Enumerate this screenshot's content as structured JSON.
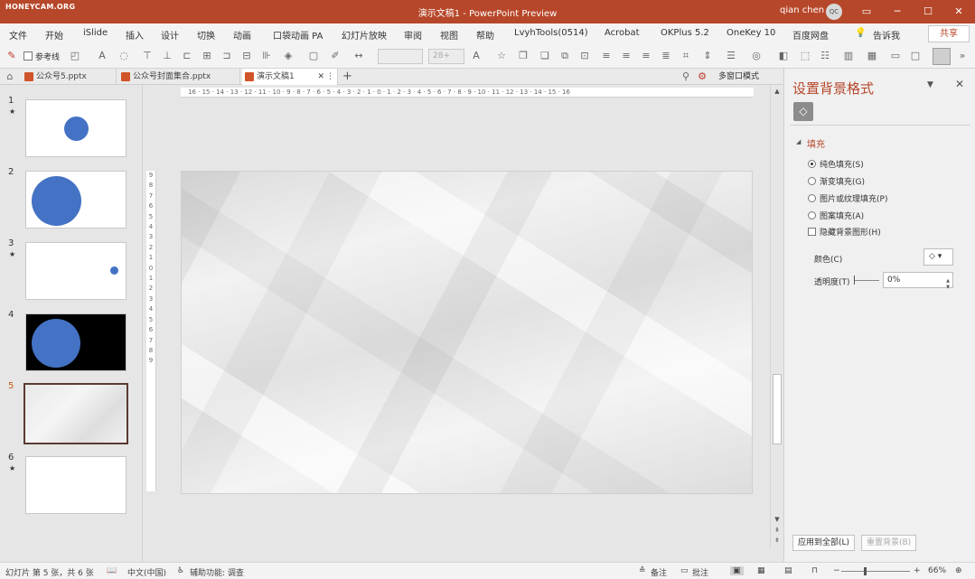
{
  "titlebar": {
    "watermark": "HONEYCAM.ORG",
    "title": "演示文稿1  -  PowerPoint Preview",
    "user": "qian chen",
    "avatar": "QC"
  },
  "ribbon": {
    "tabs": [
      "文件",
      "开始",
      "iSlide",
      "插入",
      "设计",
      "切换",
      "动画",
      "口袋动画 PA",
      "幻灯片放映",
      "审阅",
      "视图",
      "帮助",
      "LvyhTools(0514)",
      "Acrobat",
      "OKPlus 5.2",
      "OneKey 10",
      "百度网盘"
    ],
    "tell_me": "告诉我",
    "share": "共享"
  },
  "toolbar": {
    "guides_label": "参考线",
    "font_size": "28+"
  },
  "doctabs": [
    {
      "label": "公众号5.pptx"
    },
    {
      "label": "公众号封面集合.pptx"
    },
    {
      "label": "演示文稿1"
    }
  ],
  "multiwindow": "多窗口模式",
  "thumbnails": [
    {
      "num": "1",
      "star": "★"
    },
    {
      "num": "2",
      "star": ""
    },
    {
      "num": "3",
      "star": "★"
    },
    {
      "num": "4",
      "star": ""
    },
    {
      "num": "5",
      "star": ""
    },
    {
      "num": "6",
      "star": "★"
    }
  ],
  "rulers": {
    "horizontal": "16 · 15 · 14 · 13 · 12 · 11 · 10 · 9 · 8 · 7 · 6 · 5 · 4 · 3 · 2 · 1 · 0 · 1 · 2 · 3 · 4 · 5 · 6 · 7 · 8 · 9 · 10 · 11 · 12 · 13 · 14 · 15 · 16",
    "vertical": [
      "9",
      "8",
      "7",
      "6",
      "5",
      "4",
      "3",
      "2",
      "1",
      "0",
      "1",
      "2",
      "3",
      "4",
      "5",
      "6",
      "7",
      "8",
      "9"
    ]
  },
  "format_pane": {
    "title": "设置背景格式",
    "section": "填充",
    "fill_options": [
      "纯色填充(S)",
      "渐变填充(G)",
      "图片或纹理填充(P)",
      "图案填充(A)"
    ],
    "hide_bg_graphics": "隐藏背景图形(H)",
    "color_label": "颜色(C)",
    "transparency_label": "透明度(T)",
    "transparency_value": "0%",
    "apply_all": "应用到全部(L)",
    "reset_bg": "重置背景(B)"
  },
  "statusbar": {
    "slide_info": "幻灯片 第 5 张，共 6 张",
    "language": "中文(中国)",
    "accessibility": "辅助功能: 调查",
    "notes": "备注",
    "comments": "批注",
    "zoom": "66%"
  }
}
